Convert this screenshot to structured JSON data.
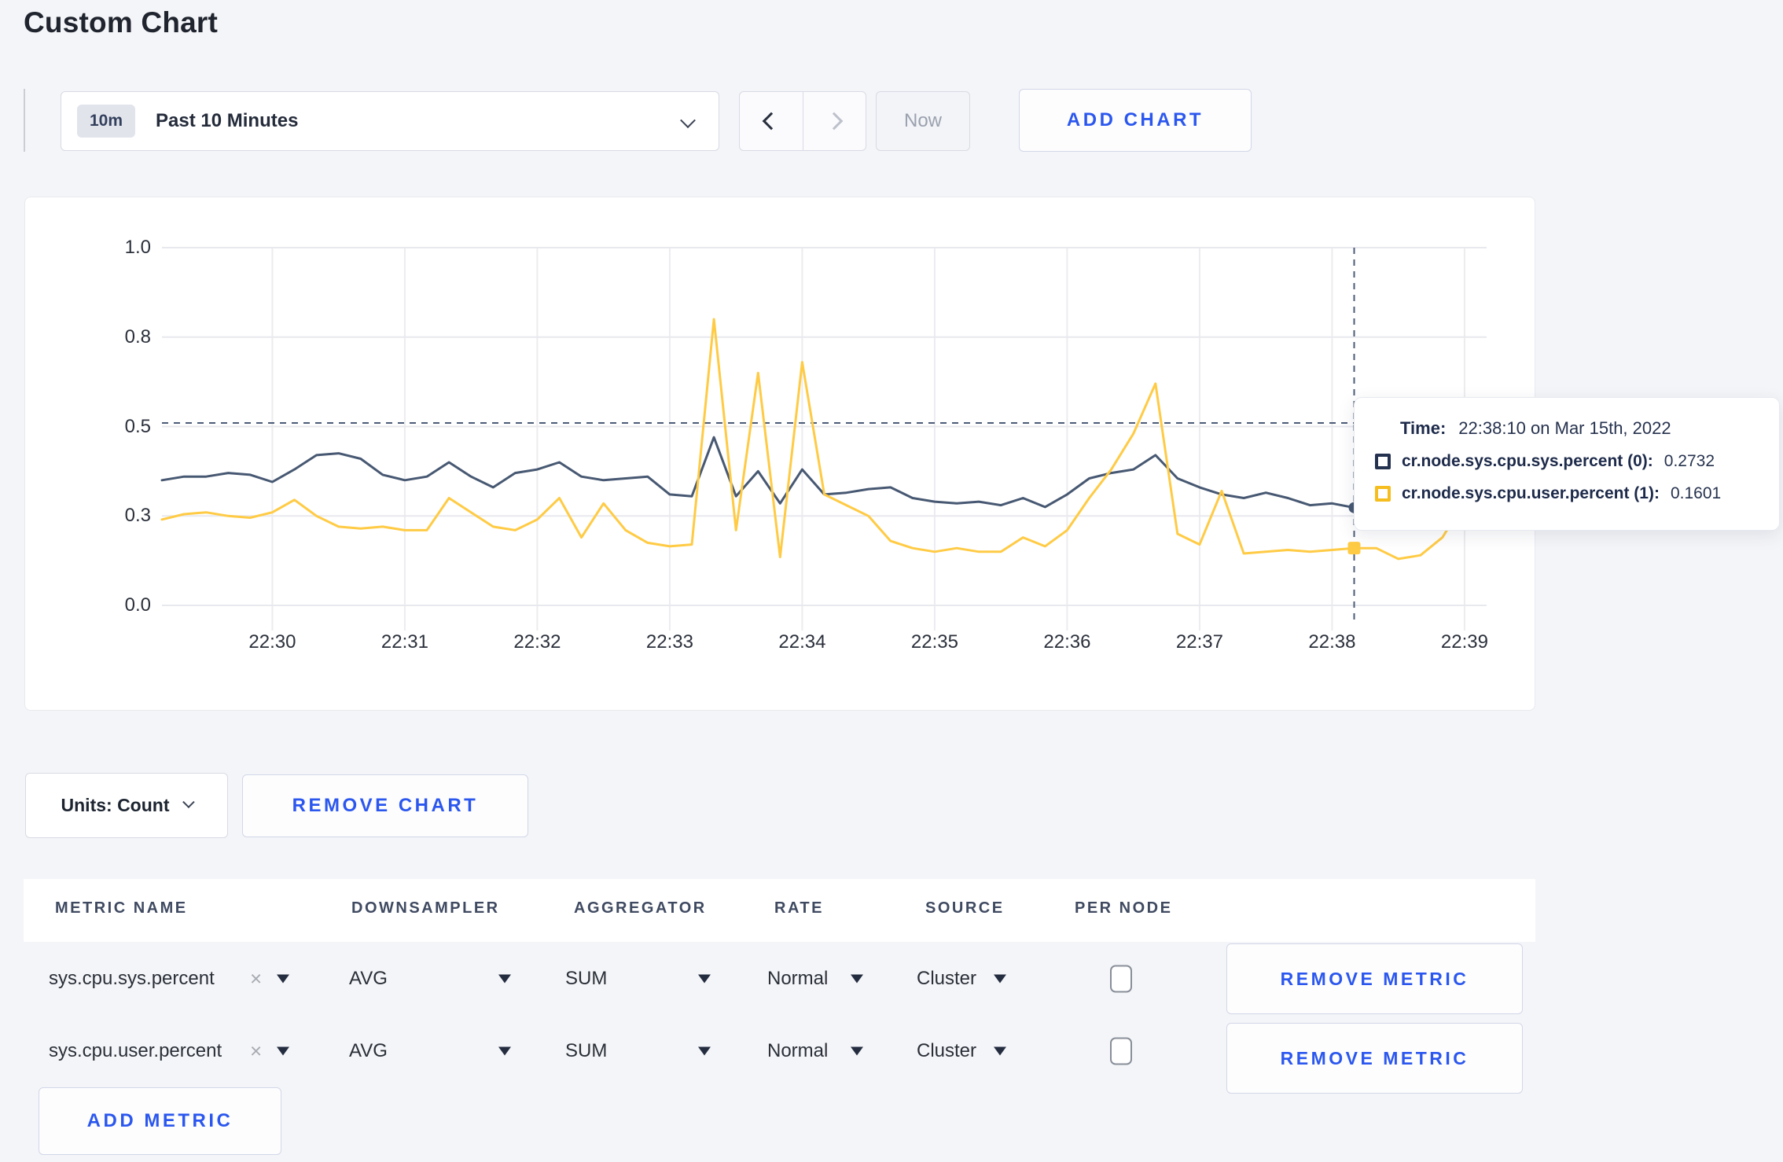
{
  "page": {
    "title": "Custom Chart"
  },
  "toolbar": {
    "time_range": {
      "badge": "10m",
      "label": "Past 10 Minutes"
    },
    "now_label": "Now",
    "add_chart_label": "ADD CHART"
  },
  "chart_controls": {
    "units_label": "Units: Count",
    "remove_chart_label": "REMOVE CHART",
    "add_metric_label": "ADD METRIC"
  },
  "metrics_table": {
    "headers": [
      "METRIC NAME",
      "DOWNSAMPLER",
      "AGGREGATOR",
      "RATE",
      "SOURCE",
      "PER NODE"
    ],
    "remove_metric_label": "REMOVE METRIC",
    "rows": [
      {
        "metric": "sys.cpu.sys.percent",
        "downsampler": "AVG",
        "aggregator": "SUM",
        "rate": "Normal",
        "source": "Cluster",
        "per_node_checked": false
      },
      {
        "metric": "sys.cpu.user.percent",
        "downsampler": "AVG",
        "aggregator": "SUM",
        "rate": "Normal",
        "source": "Cluster",
        "per_node_checked": false
      }
    ]
  },
  "chart_data": {
    "type": "line",
    "title": "",
    "xlabel": "",
    "ylabel": "",
    "grid": true,
    "legend_position": "none",
    "ylim": [
      0,
      1
    ],
    "y_ticks": [
      {
        "v": 0.0,
        "label": "0.0"
      },
      {
        "v": 0.25,
        "label": "0.3"
      },
      {
        "v": 0.5,
        "label": "0.5"
      },
      {
        "v": 0.75,
        "label": "0.8"
      },
      {
        "v": 1.0,
        "label": "1.0"
      }
    ],
    "x_domain_seconds": [
      0,
      600
    ],
    "x_start_time": "22:29:10",
    "x_end_time": "22:39:10",
    "x_ticks": [
      {
        "t": 50,
        "label": "22:30"
      },
      {
        "t": 110,
        "label": "22:31"
      },
      {
        "t": 170,
        "label": "22:32"
      },
      {
        "t": 230,
        "label": "22:33"
      },
      {
        "t": 290,
        "label": "22:34"
      },
      {
        "t": 350,
        "label": "22:35"
      },
      {
        "t": 410,
        "label": "22:36"
      },
      {
        "t": 470,
        "label": "22:37"
      },
      {
        "t": 530,
        "label": "22:38"
      },
      {
        "t": 590,
        "label": "22:39"
      }
    ],
    "t_seconds": [
      0,
      10,
      20,
      30,
      40,
      50,
      60,
      70,
      80,
      90,
      100,
      110,
      120,
      130,
      140,
      150,
      160,
      170,
      180,
      190,
      200,
      210,
      220,
      230,
      240,
      250,
      260,
      270,
      280,
      290,
      300,
      310,
      320,
      330,
      340,
      350,
      360,
      370,
      380,
      390,
      400,
      410,
      420,
      430,
      440,
      450,
      460,
      470,
      480,
      490,
      500,
      510,
      520,
      530,
      540,
      550,
      560,
      570,
      580,
      590,
      600
    ],
    "series": [
      {
        "name": "cr.node.sys.cpu.sys.percent",
        "color": "#475872",
        "values": [
          0.35,
          0.36,
          0.36,
          0.37,
          0.365,
          0.345,
          0.38,
          0.42,
          0.425,
          0.41,
          0.365,
          0.35,
          0.36,
          0.4,
          0.36,
          0.33,
          0.37,
          0.38,
          0.4,
          0.36,
          0.35,
          0.355,
          0.36,
          0.31,
          0.305,
          0.47,
          0.305,
          0.375,
          0.285,
          0.38,
          0.31,
          0.315,
          0.325,
          0.33,
          0.3,
          0.29,
          0.285,
          0.29,
          0.28,
          0.3,
          0.275,
          0.31,
          0.355,
          0.37,
          0.38,
          0.42,
          0.355,
          0.33,
          0.31,
          0.3,
          0.315,
          0.3,
          0.28,
          0.285,
          0.2732,
          0.3,
          0.32,
          0.31,
          0.3,
          0.3,
          0.315
        ]
      },
      {
        "name": "cr.node.sys.cpu.user.percent",
        "color": "#ffcb45",
        "values": [
          0.24,
          0.255,
          0.26,
          0.25,
          0.245,
          0.26,
          0.295,
          0.25,
          0.22,
          0.215,
          0.22,
          0.21,
          0.21,
          0.3,
          0.26,
          0.22,
          0.21,
          0.24,
          0.3,
          0.19,
          0.285,
          0.21,
          0.175,
          0.165,
          0.17,
          0.8,
          0.21,
          0.65,
          0.135,
          0.68,
          0.31,
          0.28,
          0.25,
          0.18,
          0.16,
          0.15,
          0.16,
          0.15,
          0.15,
          0.19,
          0.165,
          0.21,
          0.3,
          0.38,
          0.48,
          0.62,
          0.2,
          0.17,
          0.32,
          0.145,
          0.15,
          0.155,
          0.15,
          0.155,
          0.1601,
          0.16,
          0.13,
          0.14,
          0.19,
          0.29,
          0.24
        ]
      }
    ],
    "hover": {
      "t": 540,
      "crosshair_y": 0.51,
      "time_text": "22:38:10 on Mar 15th, 2022",
      "points": [
        {
          "series": 0,
          "value": 0.2732
        },
        {
          "series": 1,
          "value": 0.1601
        }
      ]
    },
    "tooltip": {
      "time_label": "Time:",
      "rows": [
        {
          "name": "cr.node.sys.cpu.sys.percent (0):",
          "value": "0.2732",
          "swatch_color": "#24314f"
        },
        {
          "name": "cr.node.sys.cpu.user.percent (1):",
          "value": "0.1601",
          "swatch_color": "#f5bd1e"
        }
      ]
    }
  }
}
